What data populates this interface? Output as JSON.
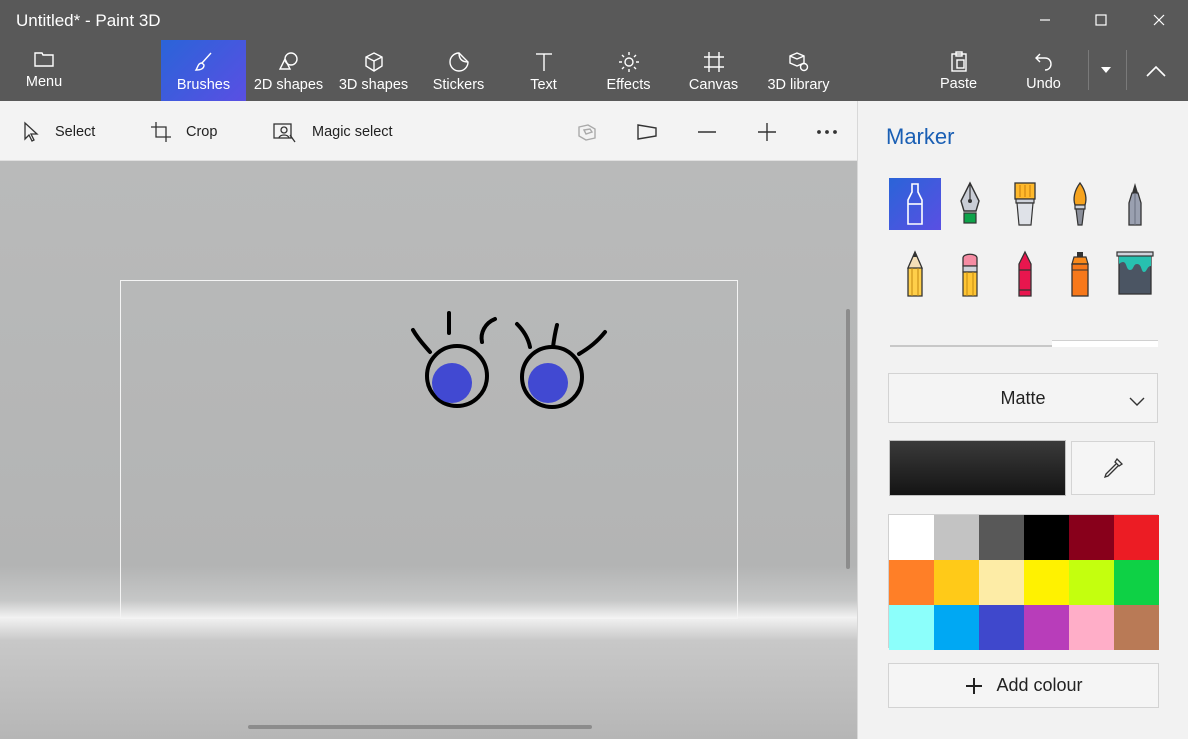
{
  "window": {
    "title": "Untitled* - Paint 3D"
  },
  "menu": {
    "label": "Menu"
  },
  "tabs": [
    {
      "label": "Brushes",
      "icon": "brush-icon",
      "active": true
    },
    {
      "label": "2D shapes",
      "icon": "2d-shapes-icon"
    },
    {
      "label": "3D shapes",
      "icon": "3d-shapes-icon"
    },
    {
      "label": "Stickers",
      "icon": "stickers-icon"
    },
    {
      "label": "Text",
      "icon": "text-icon"
    },
    {
      "label": "Effects",
      "icon": "effects-icon"
    },
    {
      "label": "Canvas",
      "icon": "canvas-icon"
    },
    {
      "label": "3D library",
      "icon": "3d-library-icon"
    }
  ],
  "actions": {
    "paste": "Paste",
    "undo": "Undo"
  },
  "subtoolbar": {
    "select": "Select",
    "crop": "Crop",
    "magic_select": "Magic select"
  },
  "panel": {
    "title": "Marker",
    "brushes": [
      "marker",
      "calligraphy-pen",
      "oil-brush",
      "watercolor",
      "pixel-pen",
      "pencil",
      "eraser",
      "crayon",
      "spray-can",
      "fill"
    ],
    "finish": "Matte",
    "current_color": "#1c1c1c",
    "palette": [
      "#ffffff",
      "#c3c3c3",
      "#585858",
      "#000000",
      "#88001b",
      "#ec1c24",
      "#ff7f27",
      "#ffca18",
      "#fdeca6",
      "#fff200",
      "#c4ff0e",
      "#0ed145",
      "#8cfffb",
      "#00a8f3",
      "#3f48cc",
      "#b83dba",
      "#ffaec8",
      "#b97a56"
    ],
    "add_colour": "Add colour"
  },
  "colors": {
    "accent": "#3b5fe0",
    "eye_fill": "#4149d2",
    "ink": "#000000"
  }
}
